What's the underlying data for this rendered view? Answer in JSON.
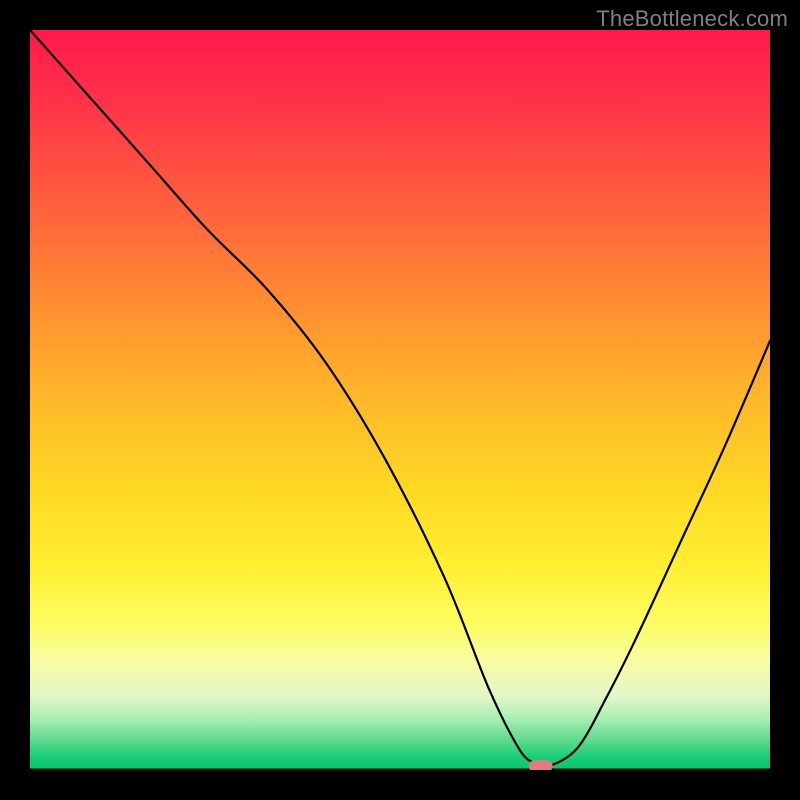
{
  "watermark": "TheBottleneck.com",
  "chart_data": {
    "type": "line",
    "title": "",
    "xlabel": "",
    "ylabel": "",
    "xlim": [
      0,
      100
    ],
    "ylim": [
      0,
      100
    ],
    "grid": false,
    "legend": false,
    "x": [
      0,
      8,
      16,
      24,
      32,
      40,
      48,
      56,
      62,
      66,
      68,
      70,
      74,
      78,
      82,
      88,
      94,
      100
    ],
    "values": [
      100,
      91,
      82,
      73,
      65,
      55,
      42,
      26,
      11,
      3,
      1,
      0.5,
      3,
      10,
      18,
      31,
      44,
      58
    ],
    "marker": {
      "x": 69,
      "y": 0.5
    },
    "background": "vertical-gradient-red-to-green"
  }
}
